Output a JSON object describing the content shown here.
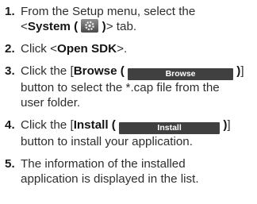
{
  "steps": [
    {
      "num": "1.",
      "line1": "From the Setup menu, select the",
      "l2_pre": "<",
      "l2_bold": "System (",
      "l2_bold_close": ")",
      "l2_post": "> tab."
    },
    {
      "num": "2.",
      "pre": "Click <",
      "bold": "Open SDK",
      "post": ">."
    },
    {
      "num": "3.",
      "pre": "Click the [",
      "bold": "Browse (",
      "btn_label": "Browse",
      "bold_close": ")",
      "post": "]",
      "line2": "button to select the *.cap file from the",
      "line3": "user folder."
    },
    {
      "num": "4.",
      "pre": "Click the [",
      "bold": "Install (",
      "btn_label": "Install",
      "bold_close": ")",
      "post": "]",
      "line2": "button to install your application."
    },
    {
      "num": "5.",
      "line1": "The information of the installed",
      "line2": "application is displayed in the list."
    }
  ],
  "icons": {
    "system_tab": "gear-icon"
  }
}
